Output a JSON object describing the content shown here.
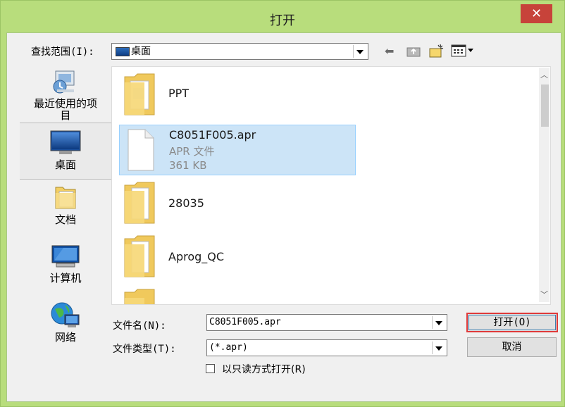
{
  "window": {
    "title": "打开",
    "close_glyph": "✕"
  },
  "lookin": {
    "label": "查找范围(I):",
    "value": "桌面"
  },
  "places": [
    {
      "label": "最近使用的项目",
      "icon": "recent-items-icon"
    },
    {
      "label": "桌面",
      "icon": "desktop-icon"
    },
    {
      "label": "文档",
      "icon": "documents-icon"
    },
    {
      "label": "计算机",
      "icon": "computer-icon"
    },
    {
      "label": "网络",
      "icon": "network-icon"
    }
  ],
  "files": [
    {
      "name": "PPT",
      "type": "folder"
    },
    {
      "name": "C8051F005.apr",
      "type": "file",
      "kind": "APR 文件",
      "size": "361 KB"
    },
    {
      "name": "28035",
      "type": "folder"
    },
    {
      "name": "Aprog_QC",
      "type": "folder"
    }
  ],
  "filename": {
    "label": "文件名(N):",
    "value": "C8051F005.apr"
  },
  "filetype": {
    "label": "文件类型(T):",
    "value": "(*.apr)"
  },
  "readonly": {
    "label": "以只读方式打开(R)",
    "checked": false
  },
  "buttons": {
    "open": "打开(O)",
    "cancel": "取消"
  },
  "colors": {
    "title_bar": "#b8dd7c",
    "close_button": "#c7433a",
    "selection": "#cce4f7",
    "focus_highlight": "#e03a3a"
  }
}
